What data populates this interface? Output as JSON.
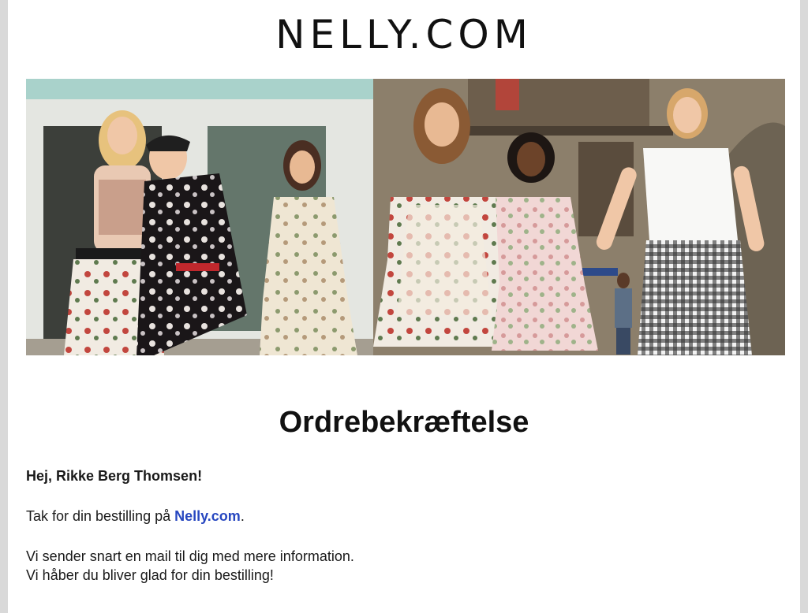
{
  "brand": {
    "logo_text": "NELLY.COM"
  },
  "hero": {
    "image_alt": "Six models in summer dresses and outfits on a street"
  },
  "email": {
    "title": "Ordrebekræftelse",
    "greeting": "Hej, Rikke Berg Thomsen!",
    "thanks_prefix": "Tak for din bestilling på ",
    "thanks_link": "Nelly.com",
    "thanks_suffix": ".",
    "info_line_1": "Vi sender snart en mail til dig med mere information.",
    "info_line_2": "Vi håber du bliver glad for din bestilling!"
  },
  "colors": {
    "link": "#2747c0",
    "text": "#1a1a1a",
    "background": "#ffffff"
  }
}
